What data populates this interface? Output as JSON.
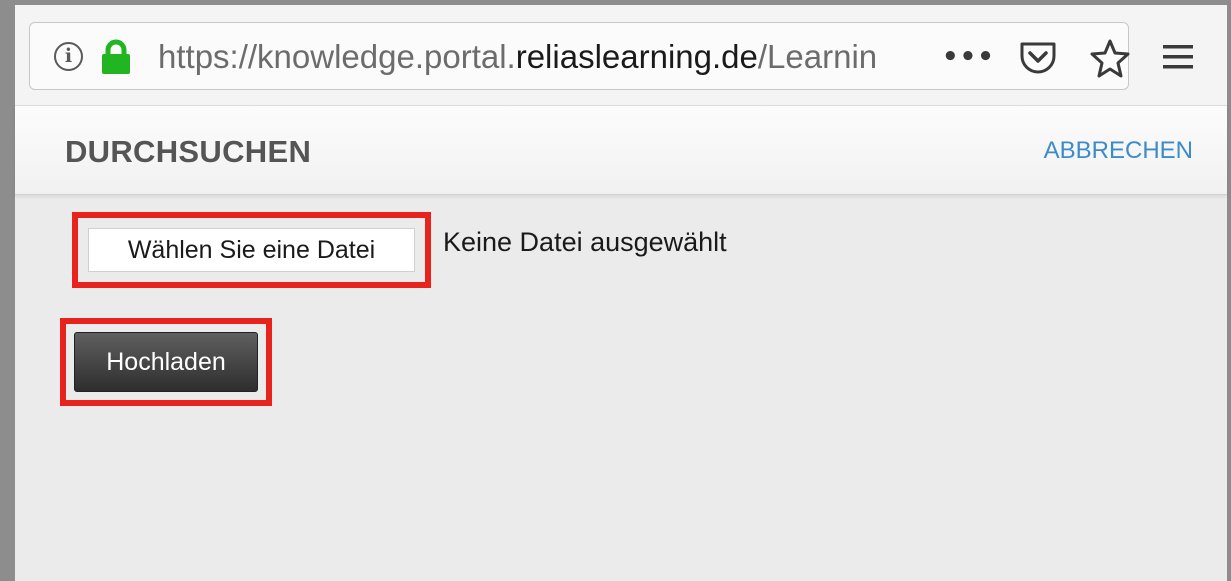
{
  "browser": {
    "url": {
      "prefix": "https://knowledge.portal.",
      "domain": "reliaslearning.de",
      "path": "/Learnin"
    },
    "icons": [
      "info-icon",
      "lock-icon",
      "more-icon",
      "pocket-icon",
      "star-icon",
      "menu-icon"
    ],
    "lock_color": "#21b521",
    "more_label": "•••"
  },
  "dialog": {
    "title": "DURCHSUCHEN",
    "cancel_label": "ABBRECHEN",
    "choose_file_label": "Wählen Sie eine Datei",
    "no_file_text": "Keine Datei ausgewählt",
    "upload_label": "Hochladen"
  },
  "colors": {
    "highlight": "#e8231d",
    "link": "#3d8cc9",
    "upload_button": "#3c3c3c"
  }
}
